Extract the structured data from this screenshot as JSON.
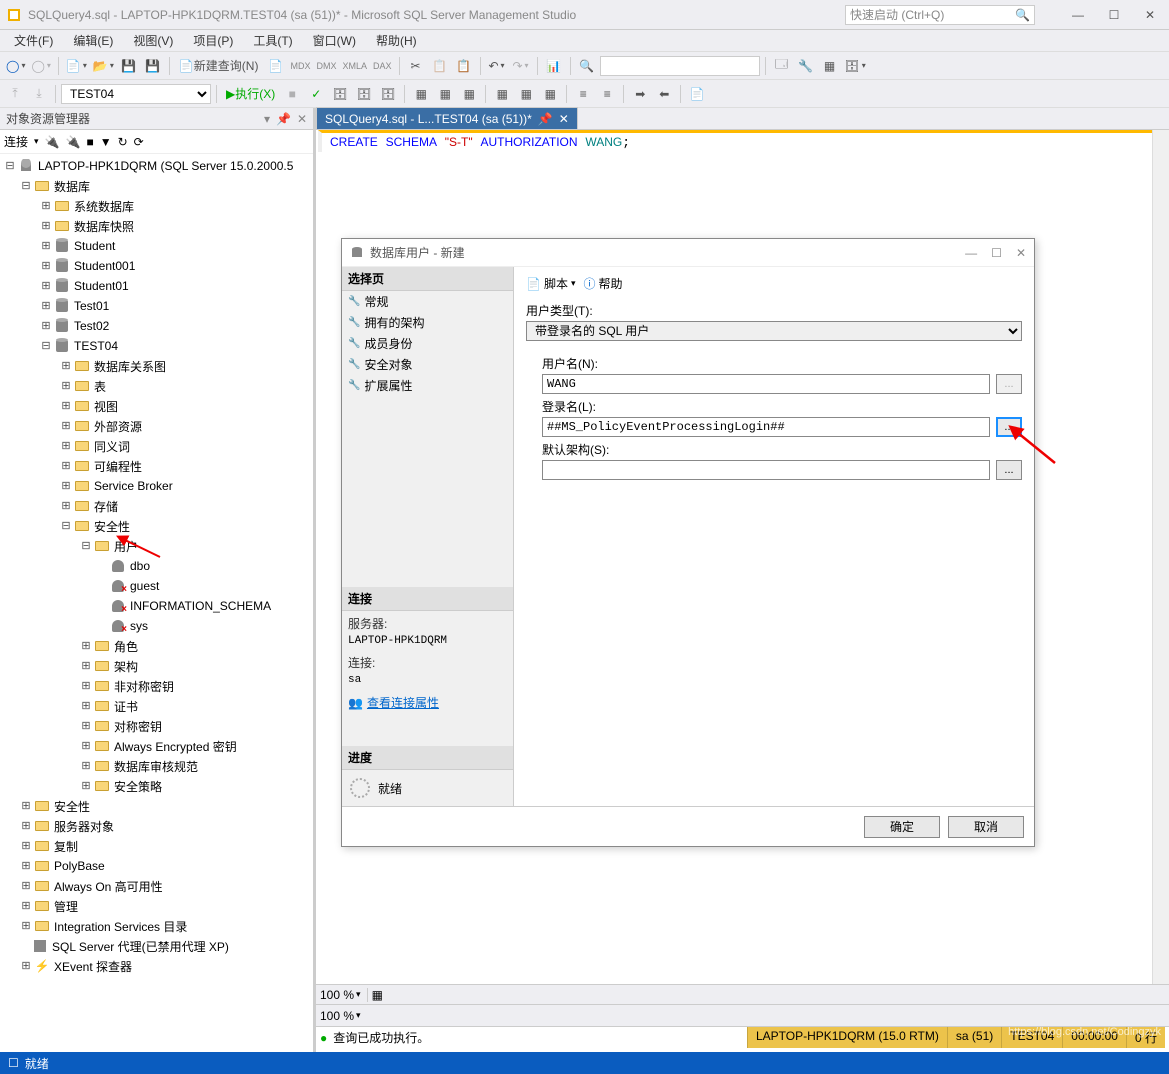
{
  "title": "SQLQuery4.sql - LAPTOP-HPK1DQRM.TEST04 (sa (51))* - Microsoft SQL Server Management Studio",
  "quick_launch_placeholder": "快速启动 (Ctrl+Q)",
  "menu": {
    "file": "文件(F)",
    "edit": "编辑(E)",
    "view": "视图(V)",
    "project": "项目(P)",
    "tools": "工具(T)",
    "window": "窗口(W)",
    "help": "帮助(H)"
  },
  "toolbar": {
    "new_query": "新建查询(N)",
    "execute": "执行(X)",
    "db_combo": "TEST04"
  },
  "sidebar": {
    "title": "对象资源管理器",
    "connect": "连接",
    "root": "LAPTOP-HPK1DQRM (SQL Server 15.0.2000.5",
    "databases": "数据库",
    "sys_db": "系统数据库",
    "db_snapshot": "数据库快照",
    "dbs": [
      "Student",
      "Student001",
      "Student01",
      "Test01",
      "Test02",
      "TEST04"
    ],
    "test04_children": {
      "diagram": "数据库关系图",
      "tables": "表",
      "views": "视图",
      "ext_res": "外部资源",
      "synonyms": "同义词",
      "programmability": "可编程性",
      "service_broker": "Service Broker",
      "storage": "存储",
      "security": "安全性"
    },
    "security_children": {
      "users": "用户",
      "dbo": "dbo",
      "guest": "guest",
      "info_schema": "INFORMATION_SCHEMA",
      "sys": "sys",
      "roles": "角色",
      "schemas": "架构",
      "asym_keys": "非对称密钥",
      "certs": "证书",
      "sym_keys": "对称密钥",
      "ae_keys": "Always Encrypted 密钥",
      "audit": "数据库审核规范",
      "policy": "安全策略"
    },
    "top_level": {
      "security": "安全性",
      "server_obj": "服务器对象",
      "replication": "复制",
      "polybase": "PolyBase",
      "always_on": "Always On 高可用性",
      "management": "管理",
      "integration": "Integration Services 目录",
      "agent": "SQL Server 代理(已禁用代理 XP)",
      "xevent": "XEvent 探查器"
    }
  },
  "editor": {
    "tab": "SQLQuery4.sql - L...TEST04 (sa (51))*",
    "code": {
      "kw1": "CREATE",
      "kw2": "SCHEMA",
      "str": "\"S-T\"",
      "kw3": "AUTHORIZATION",
      "id": "WANG"
    },
    "zoom": "100 %",
    "zoom2": "100 %",
    "exec_msg": "查询已成功执行。",
    "status": {
      "server": "LAPTOP-HPK1DQRM (15.0 RTM)",
      "user": "sa (51)",
      "db": "TEST04",
      "time": "00:00:00",
      "rows": "0 行"
    }
  },
  "dialog": {
    "title": "数据库用户 - 新建",
    "select_page": "选择页",
    "pages": {
      "general": "常规",
      "owned_schemas": "拥有的架构",
      "membership": "成员身份",
      "securables": "安全对象",
      "ext_props": "扩展属性"
    },
    "connection": "连接",
    "server_lbl": "服务器:",
    "server": "LAPTOP-HPK1DQRM",
    "conn_lbl": "连接:",
    "conn_val": "sa",
    "view_props": "查看连接属性",
    "progress": "进度",
    "ready": "就绪",
    "script": "脚本",
    "help": "帮助",
    "user_type_lbl": "用户类型(T):",
    "user_type": "带登录名的 SQL 用户",
    "user_name_lbl": "用户名(N):",
    "user_name": "WANG",
    "login_lbl": "登录名(L):",
    "login": "##MS_PolicyEventProcessingLogin##",
    "schema_lbl": "默认架构(S):",
    "schema": "",
    "ok": "确定",
    "cancel": "取消"
  },
  "statusbar": {
    "ready": "就绪"
  },
  "watermark": "https://blog.csdn.net/Codingzyk"
}
